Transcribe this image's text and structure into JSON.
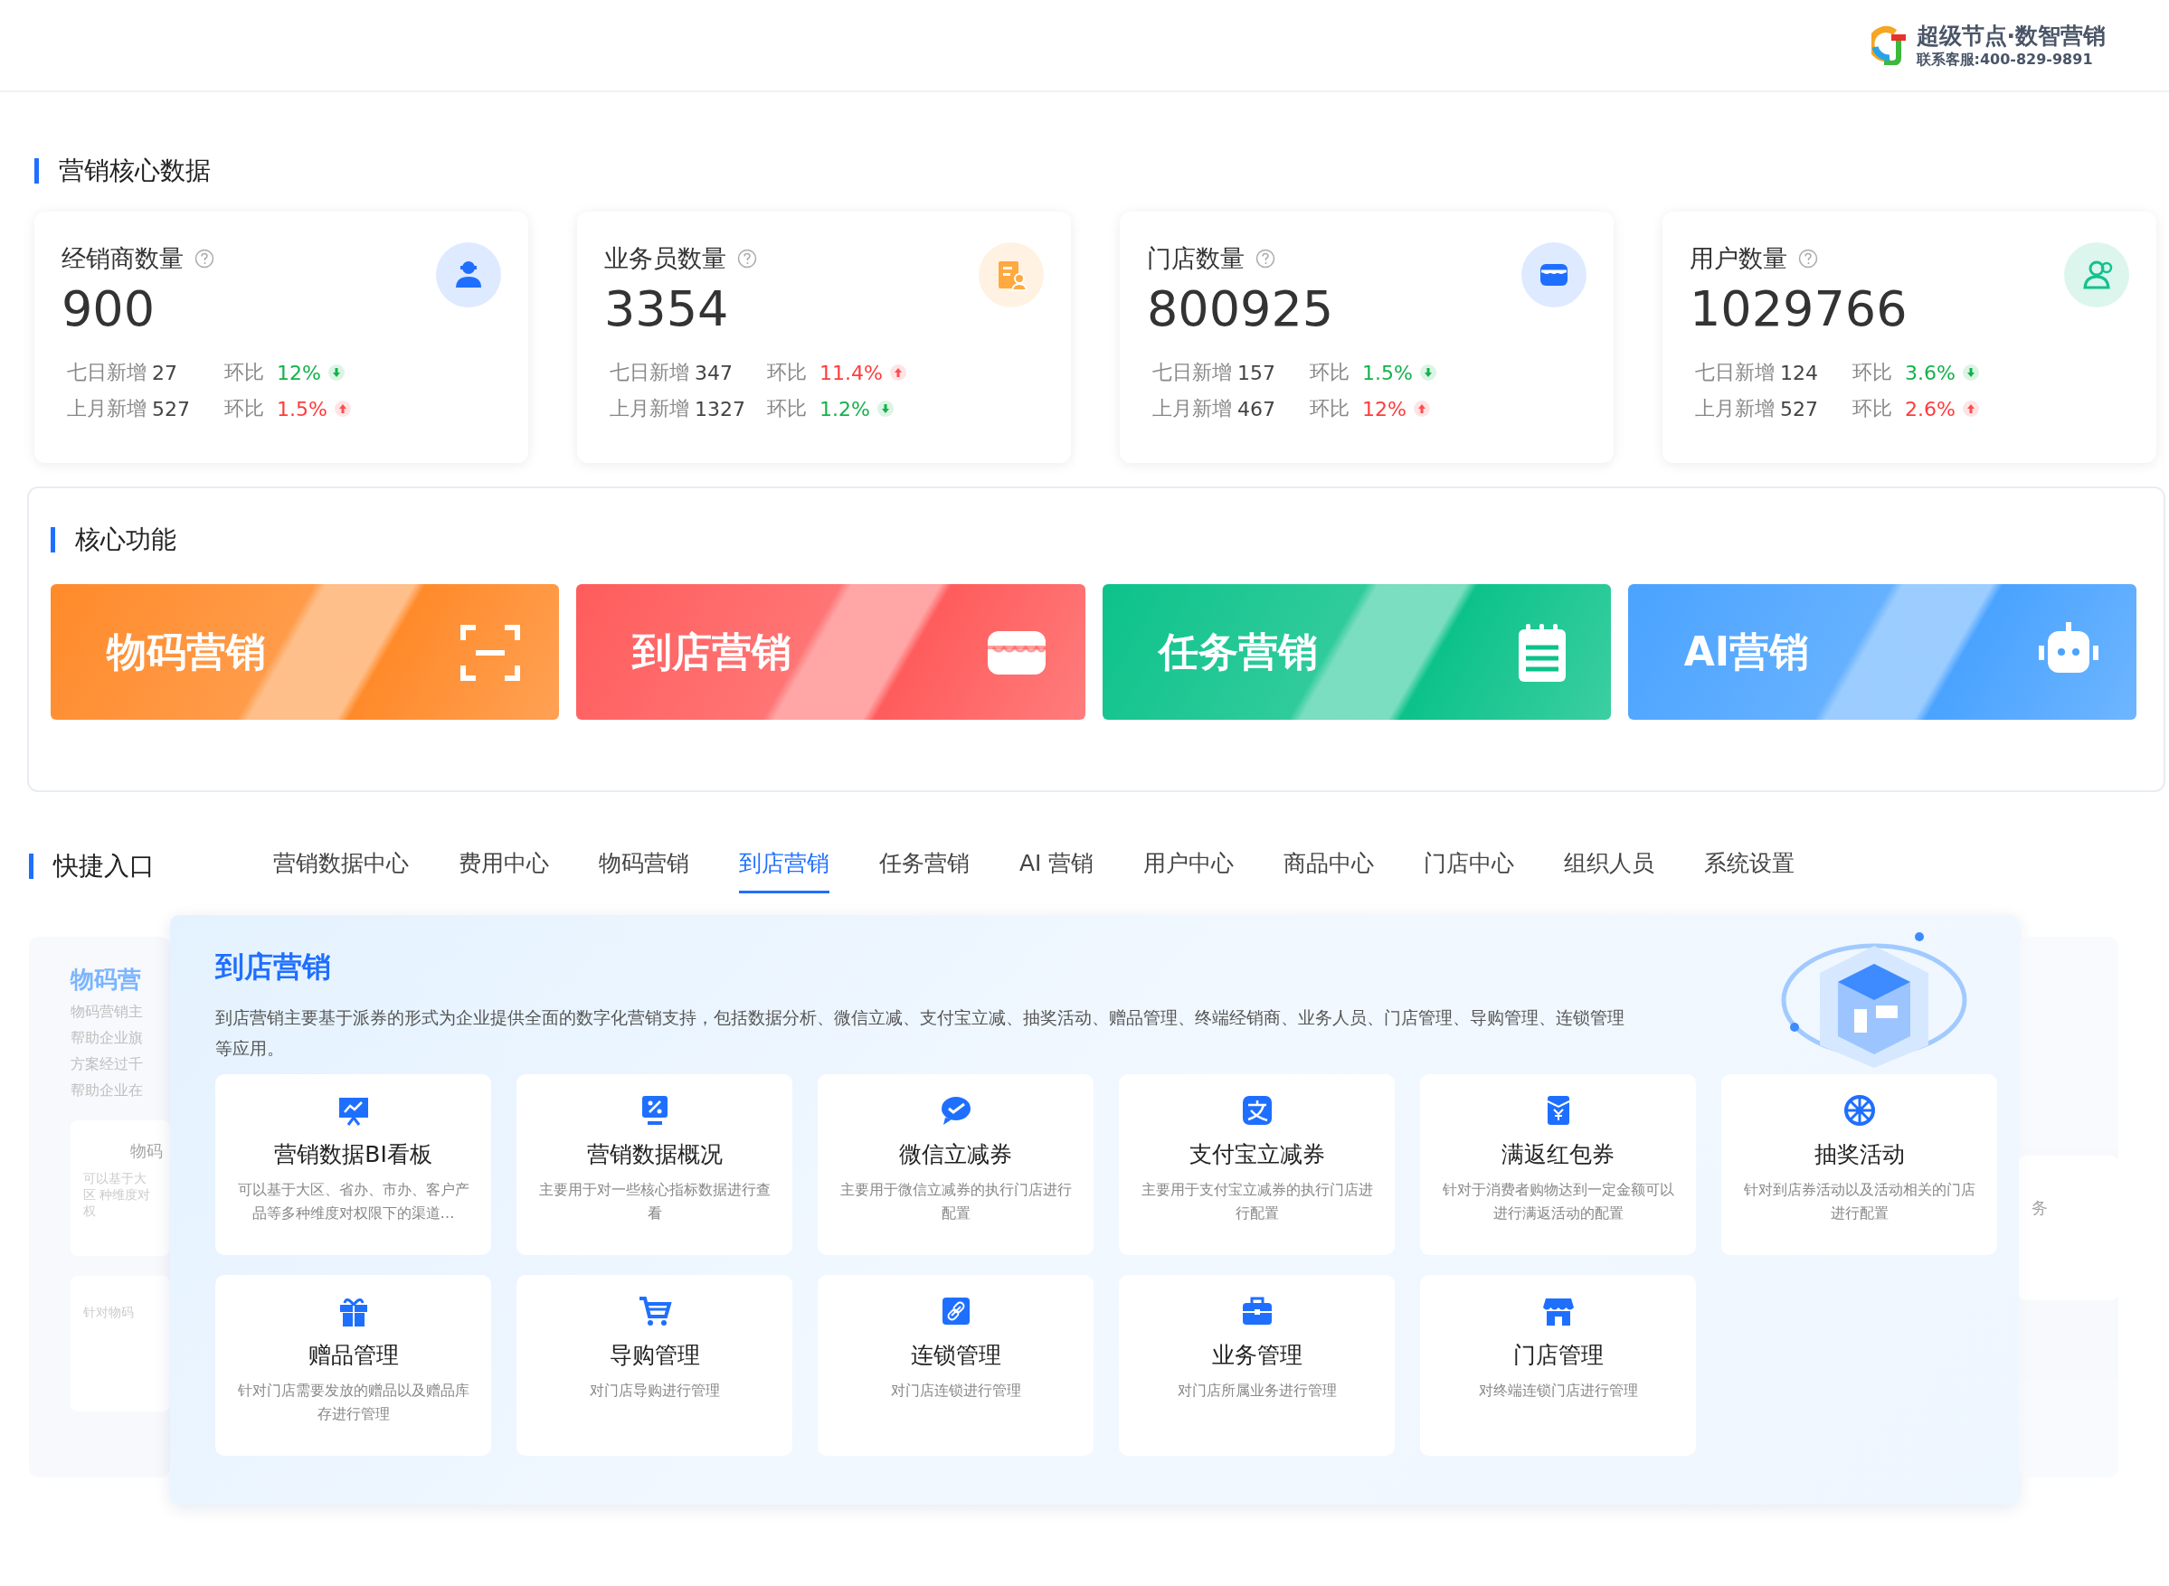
{
  "header": {
    "brand": "超级节点·数智营销",
    "hotline": "联系客服:400-829-9891"
  },
  "core_data": {
    "title": "营销核心数据",
    "cards": [
      {
        "title": "经销商数量",
        "value": "900",
        "color": "#1f6fff",
        "rows": [
          {
            "label": "七日新增",
            "count": "27",
            "ratio_label": "环比",
            "ratio": "12%",
            "rising": false
          },
          {
            "label": "上月新增",
            "count": "527",
            "ratio_label": "环比",
            "ratio": "1.5%",
            "rising": true
          }
        ]
      },
      {
        "title": "业务员数量",
        "value": "3354",
        "color": "#ffa940",
        "rows": [
          {
            "label": "七日新增",
            "count": "347",
            "ratio_label": "环比",
            "ratio": "11.4%",
            "rising": true
          },
          {
            "label": "上月新增",
            "count": "1327",
            "ratio_label": "环比",
            "ratio": "1.2%",
            "rising": false
          }
        ]
      },
      {
        "title": "门店数量",
        "value": "800925",
        "color": "#1f6fff",
        "rows": [
          {
            "label": "七日新增",
            "count": "157",
            "ratio_label": "环比",
            "ratio": "1.5%",
            "rising": false
          },
          {
            "label": "上月新增",
            "count": "467",
            "ratio_label": "环比",
            "ratio": "12%",
            "rising": true
          }
        ]
      },
      {
        "title": "用户数量",
        "value": "1029766",
        "color": "#13c28d",
        "rows": [
          {
            "label": "七日新增",
            "count": "124",
            "ratio_label": "环比",
            "ratio": "3.6%",
            "rising": false
          },
          {
            "label": "上月新增",
            "count": "527",
            "ratio_label": "环比",
            "ratio": "2.6%",
            "rising": true
          }
        ]
      }
    ]
  },
  "core_functions": {
    "title": "核心功能",
    "tiles": [
      {
        "label": "物码营销",
        "color": "#ff8a2a"
      },
      {
        "label": "到店营销",
        "color": "#ff5c5c"
      },
      {
        "label": "任务营销",
        "color": "#0cc28a"
      },
      {
        "label": "AI营销",
        "color": "#4aa3ff"
      }
    ]
  },
  "quick_entry": {
    "title": "快捷入口",
    "tabs": [
      {
        "label": "营销数据中心",
        "selected": false
      },
      {
        "label": "费用中心",
        "selected": false
      },
      {
        "label": "物码营销",
        "selected": false
      },
      {
        "label": "到店营销",
        "selected": true
      },
      {
        "label": "任务营销",
        "selected": false
      },
      {
        "label": "AI 营销",
        "selected": false
      },
      {
        "label": "用户中心",
        "selected": false
      },
      {
        "label": "商品中心",
        "selected": false
      },
      {
        "label": "门店中心",
        "selected": false
      },
      {
        "label": "组织人员",
        "selected": false
      },
      {
        "label": "系统设置",
        "selected": false
      }
    ],
    "back_left": {
      "title": "物码营",
      "lines": [
        "物码营销主",
        "帮助企业旗",
        "方案经过千",
        "帮助企业在"
      ],
      "cards": [
        {
          "title": "物码",
          "desc": "可以基于大区 种维度对权"
        },
        {
          "desc": "针对物码"
        }
      ]
    },
    "back_right": {
      "cards": [
        {
          "title": "务"
        }
      ]
    },
    "panel": {
      "title": "到店营销",
      "description": "到店营销主要基于派券的形式为企业提供全面的数字化营销支持，包括数据分析、微信立减、支付宝立减、抽奖活动、赠品管理、终端经销商、业务人员、门店管理、导购管理、连锁管理等应用。",
      "items": [
        {
          "title": "营销数据BI看板",
          "desc": "可以基于大区、省办、市办、客户产品等多种维度对权限下的渠道…"
        },
        {
          "title": "营销数据概况",
          "desc": "主要用于对一些核心指标数据进行查看"
        },
        {
          "title": "微信立减券",
          "desc": "主要用于微信立减券的执行门店进行配置"
        },
        {
          "title": "支付宝立减券",
          "desc": "主要用于支付宝立减券的执行门店进行配置"
        },
        {
          "title": "满返红包券",
          "desc": "针对于消费者购物达到一定金额可以进行满返活动的配置"
        },
        {
          "title": "抽奖活动",
          "desc": "针对到店券活动以及活动相关的门店进行配置"
        },
        {
          "title": "赠品管理",
          "desc": "针对门店需要发放的赠品以及赠品库存进行管理"
        },
        {
          "title": "导购管理",
          "desc": "对门店导购进行管理"
        },
        {
          "title": "连锁管理",
          "desc": "对门店连锁进行管理"
        },
        {
          "title": "业务管理",
          "desc": "对门店所属业务进行管理"
        },
        {
          "title": "门店管理",
          "desc": "对终端连锁门店进行管理"
        }
      ]
    }
  }
}
